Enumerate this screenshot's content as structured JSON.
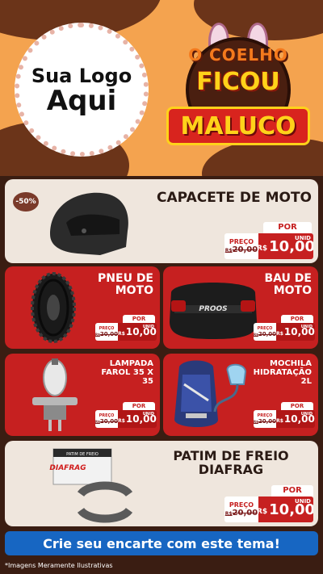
{
  "header": {
    "logo_line1": "Sua Logo",
    "logo_line2": "Aqui",
    "badge_top": "O COELHO",
    "badge_mid": "FICOU",
    "badge_ribbon": "MALUCO"
  },
  "products": [
    {
      "title": "CAPACETE DE MOTO",
      "discount": "-50%",
      "por": "POR",
      "preco": "PREÇO",
      "old_prefix": "R$",
      "old_price": "20,00",
      "currency": "R$",
      "price": "10,00",
      "unit": "UNID"
    },
    {
      "title": "PNEU DE MOTO",
      "por": "POR",
      "preco": "PREÇO",
      "old_prefix": "R$",
      "old_price": "20,00",
      "currency": "R$",
      "price": "10,00",
      "unit": "UNID"
    },
    {
      "title": "BAU DE MOTO",
      "por": "POR",
      "preco": "PREÇO",
      "old_prefix": "R$",
      "old_price": "20,00",
      "currency": "R$",
      "price": "10,00",
      "unit": "UNID"
    },
    {
      "title": "LAMPADA FAROL 35 X 35",
      "por": "POR",
      "preco": "PREÇO",
      "old_prefix": "R$",
      "old_price": "20,00",
      "currency": "R$",
      "price": "10,00",
      "unit": "UNID"
    },
    {
      "title": "MOCHILA HIDRATAÇÃO 2L",
      "por": "POR",
      "preco": "PREÇO",
      "old_prefix": "R$",
      "old_price": "20,00",
      "currency": "R$",
      "price": "10,00",
      "unit": "UNID"
    },
    {
      "title": "PATIM DE FREIO DIAFRAG",
      "por": "POR",
      "preco": "PREÇO",
      "old_prefix": "R$",
      "old_price": "20,00",
      "currency": "R$",
      "price": "10,00",
      "unit": "UNID"
    }
  ],
  "product_images": {
    "trunk_brand": "PROOS",
    "brake_brand": "DIAFRAG",
    "brake_box_text": "PATIM DE FREIO"
  },
  "cta": "Crie seu encarte com este tema!",
  "disclaimer": "*Imagens Meramente Ilustrativas",
  "colors": {
    "accent_red": "#c62020",
    "background_orange": "#f4a34f",
    "chocolate": "#6b3419",
    "cta_blue": "#1766c2",
    "price_yellow": "#ffd21a"
  }
}
